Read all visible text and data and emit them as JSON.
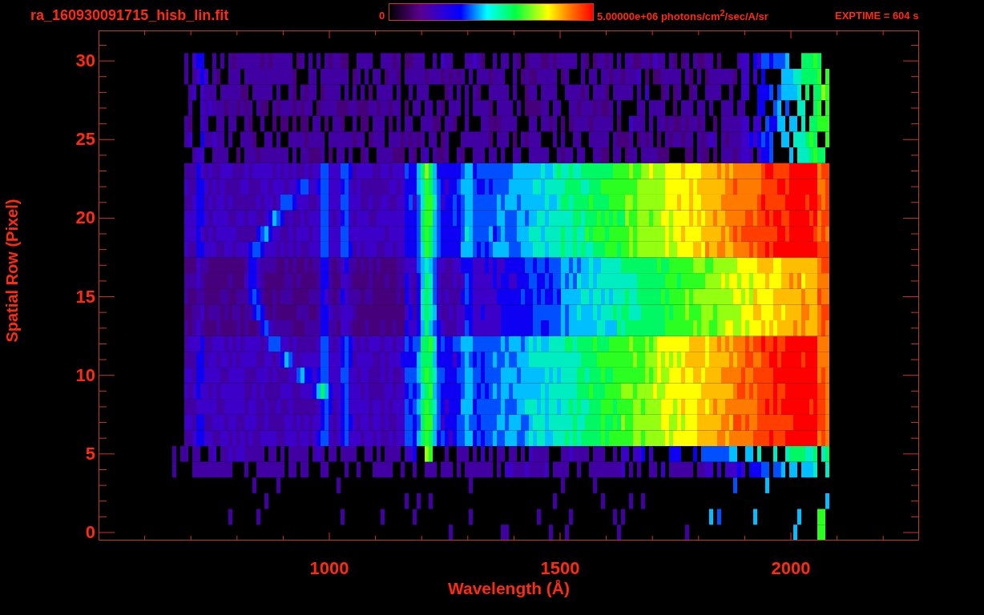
{
  "header": {
    "title": "ra_160930091715_hisb_lin.fit",
    "colorbar_min": "0",
    "colorbar_max": "5.00000e+06 photons/cm$^{2}$/sec/A/sr",
    "exposure": "EXPTIME = 604 s"
  },
  "plot": {
    "xlabel": "Wavelength (Å)",
    "ylabel": "Spatial Row (Pixel)",
    "xticks": [
      "1000",
      "1500",
      "2000"
    ],
    "yticks": [
      "30",
      "25",
      "20",
      "15",
      "10",
      "5",
      "0"
    ]
  }
}
